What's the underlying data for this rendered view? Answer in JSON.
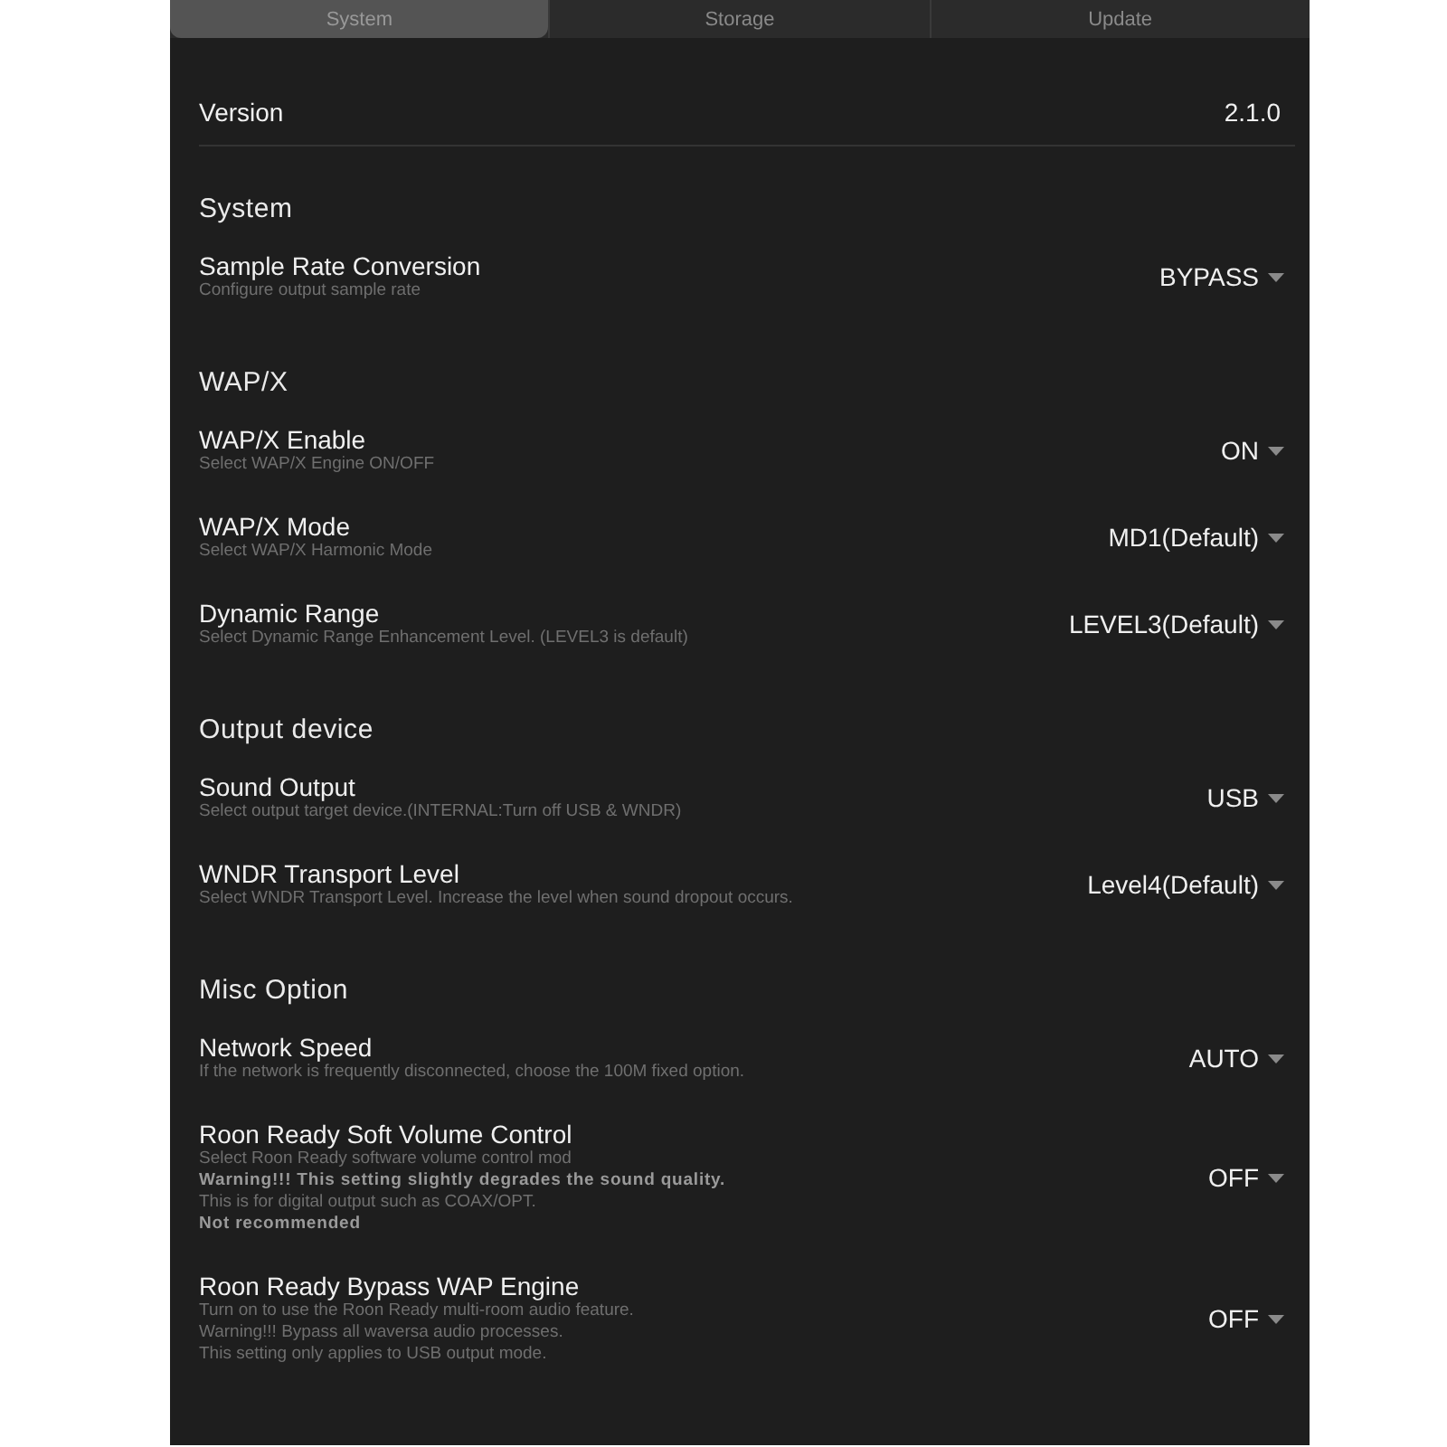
{
  "tabs": [
    {
      "label": "System",
      "selected": true
    },
    {
      "label": "Storage",
      "selected": false
    },
    {
      "label": "Update",
      "selected": false
    }
  ],
  "version": {
    "label": "Version",
    "value": "2.1.0"
  },
  "sections": [
    {
      "title": "System",
      "settings": [
        {
          "title": "Sample Rate Conversion",
          "description": [
            {
              "text": "Configure output sample rate",
              "emphasis": false
            }
          ],
          "value": "BYPASS"
        }
      ]
    },
    {
      "title": "WAP/X",
      "settings": [
        {
          "title": "WAP/X Enable",
          "description": [
            {
              "text": "Select WAP/X Engine ON/OFF",
              "emphasis": false
            }
          ],
          "value": "ON"
        },
        {
          "title": "WAP/X Mode",
          "description": [
            {
              "text": "Select WAP/X Harmonic Mode",
              "emphasis": false
            }
          ],
          "value": "MD1(Default)"
        },
        {
          "title": "Dynamic Range",
          "description": [
            {
              "text": "Select Dynamic Range Enhancement Level. (LEVEL3 is default)",
              "emphasis": false
            }
          ],
          "value": "LEVEL3(Default)"
        }
      ]
    },
    {
      "title": "Output device",
      "settings": [
        {
          "title": "Sound Output",
          "description": [
            {
              "text": "Select output target device.(INTERNAL:Turn off USB & WNDR)",
              "emphasis": false
            }
          ],
          "value": "USB"
        },
        {
          "title": "WNDR Transport Level",
          "description": [
            {
              "text": "Select WNDR Transport Level. Increase the level when sound dropout occurs.",
              "emphasis": false
            }
          ],
          "value": "Level4(Default)"
        }
      ]
    },
    {
      "title": "Misc Option",
      "settings": [
        {
          "title": "Network Speed",
          "description": [
            {
              "text": "If the network is frequently disconnected, choose the 100M fixed option.",
              "emphasis": false
            }
          ],
          "value": "AUTO"
        },
        {
          "title": "Roon Ready Soft Volume Control",
          "description": [
            {
              "text": "Select Roon Ready software volume control mod",
              "emphasis": false
            },
            {
              "text": "Warning!!! This setting slightly degrades the sound quality.",
              "emphasis": true
            },
            {
              "text": "This is for digital output such as COAX/OPT.",
              "emphasis": false
            },
            {
              "text": "Not recommended",
              "emphasis": true
            }
          ],
          "value": "OFF"
        },
        {
          "title": "Roon Ready Bypass WAP Engine",
          "description": [
            {
              "text": "Turn on to use the Roon Ready multi-room audio feature.",
              "emphasis": false
            },
            {
              "text": "Warning!!! Bypass all waversa audio processes.",
              "emphasis": false
            },
            {
              "text": "This setting only applies to USB output mode.",
              "emphasis": false
            }
          ],
          "value": "OFF"
        }
      ]
    }
  ]
}
